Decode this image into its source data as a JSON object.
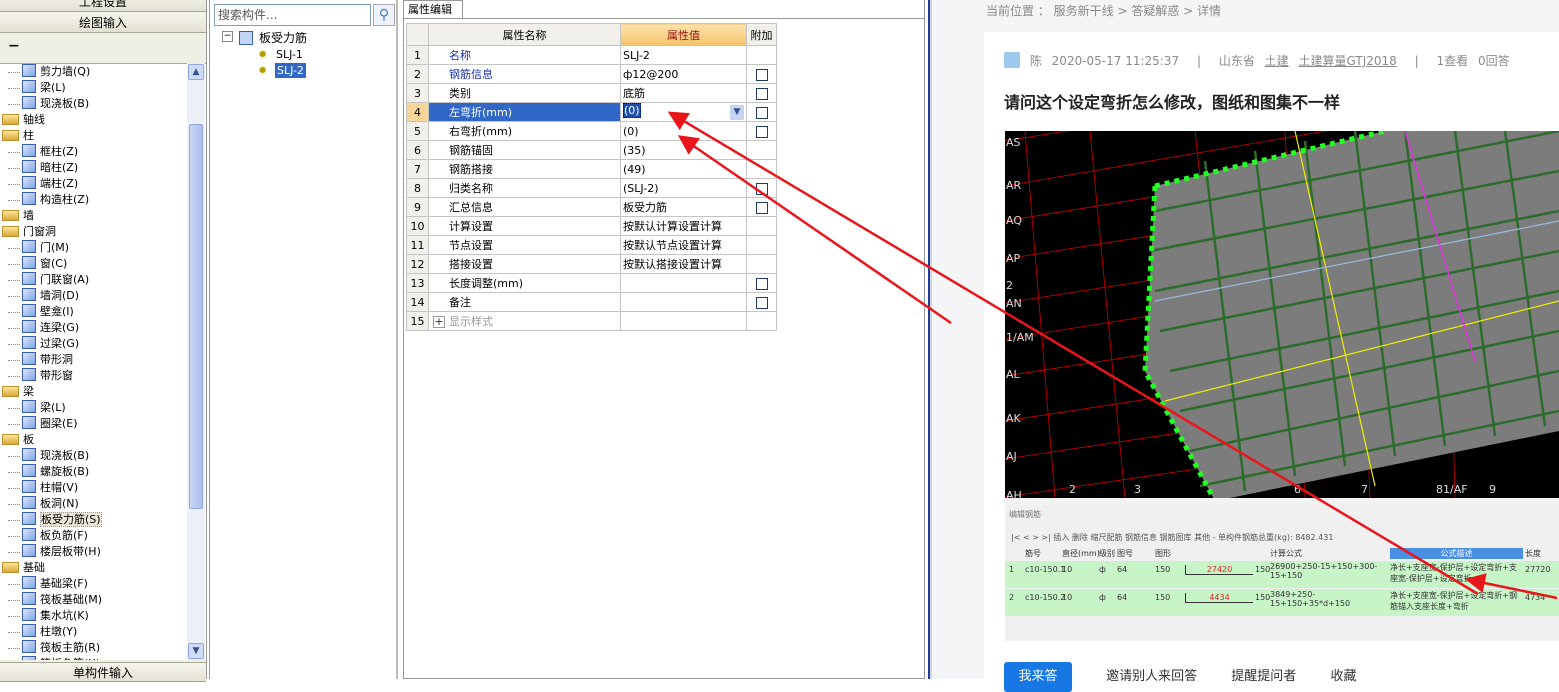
{
  "left_panel": {
    "top_button": "工程设置",
    "draw_input": "绘图输入",
    "collapse_icon": "−",
    "bottom_button": "单构件输入",
    "tree": [
      {
        "label": "剪力墙(Q)",
        "type": "child"
      },
      {
        "label": "梁(L)",
        "type": "child"
      },
      {
        "label": "现浇板(B)",
        "type": "child"
      },
      {
        "label": "轴线",
        "type": "folder"
      },
      {
        "label": "柱",
        "type": "folder"
      },
      {
        "label": "框柱(Z)",
        "type": "child"
      },
      {
        "label": "暗柱(Z)",
        "type": "child"
      },
      {
        "label": "端柱(Z)",
        "type": "child"
      },
      {
        "label": "构造柱(Z)",
        "type": "child"
      },
      {
        "label": "墙",
        "type": "folder"
      },
      {
        "label": "门窗洞",
        "type": "folder"
      },
      {
        "label": "门(M)",
        "type": "child"
      },
      {
        "label": "窗(C)",
        "type": "child"
      },
      {
        "label": "门联窗(A)",
        "type": "child"
      },
      {
        "label": "墙洞(D)",
        "type": "child"
      },
      {
        "label": "壁龛(I)",
        "type": "child"
      },
      {
        "label": "连梁(G)",
        "type": "child"
      },
      {
        "label": "过梁(G)",
        "type": "child"
      },
      {
        "label": "带形洞",
        "type": "child"
      },
      {
        "label": "带形窗",
        "type": "child"
      },
      {
        "label": "梁",
        "type": "folder"
      },
      {
        "label": "梁(L)",
        "type": "child"
      },
      {
        "label": "圈梁(E)",
        "type": "child"
      },
      {
        "label": "板",
        "type": "folder"
      },
      {
        "label": "现浇板(B)",
        "type": "child"
      },
      {
        "label": "螺旋板(B)",
        "type": "child"
      },
      {
        "label": "柱帽(V)",
        "type": "child"
      },
      {
        "label": "板洞(N)",
        "type": "child"
      },
      {
        "label": "板受力筋(S)",
        "type": "child",
        "selected": true
      },
      {
        "label": "板负筋(F)",
        "type": "child"
      },
      {
        "label": "楼层板带(H)",
        "type": "child"
      },
      {
        "label": "基础",
        "type": "folder"
      },
      {
        "label": "基础梁(F)",
        "type": "child"
      },
      {
        "label": "筏板基础(M)",
        "type": "child"
      },
      {
        "label": "集水坑(K)",
        "type": "child"
      },
      {
        "label": "柱墩(Y)",
        "type": "child"
      },
      {
        "label": "筏板主筋(R)",
        "type": "child"
      },
      {
        "label": "筏板负筋(X)",
        "type": "child"
      }
    ]
  },
  "component_tree": {
    "search_placeholder": "搜索构件...",
    "root": "板受力筋",
    "items": [
      "SLJ-1",
      "SLJ-2"
    ],
    "selected": "SLJ-2"
  },
  "property_editor": {
    "tab": "属性编辑",
    "headers": {
      "name": "属性名称",
      "value": "属性值",
      "extra": "附加"
    },
    "rows": [
      {
        "no": "1",
        "name": "名称",
        "value": "SLJ-2",
        "blue": true,
        "check": false
      },
      {
        "no": "2",
        "name": "钢筋信息",
        "value": "ф12@200",
        "blue": true,
        "check": true
      },
      {
        "no": "3",
        "name": "类别",
        "value": "底筋",
        "check": true
      },
      {
        "no": "4",
        "name": "左弯折(mm)",
        "value": "(0)",
        "check": true,
        "selected": true
      },
      {
        "no": "5",
        "name": "右弯折(mm)",
        "value": "(0)",
        "check": true
      },
      {
        "no": "6",
        "name": "钢筋锚固",
        "value": "(35)",
        "check": false
      },
      {
        "no": "7",
        "name": "钢筋搭接",
        "value": "(49)",
        "check": false
      },
      {
        "no": "8",
        "name": "归类名称",
        "value": "(SLJ-2)",
        "check": true
      },
      {
        "no": "9",
        "name": "汇总信息",
        "value": "板受力筋",
        "check": true
      },
      {
        "no": "10",
        "name": "计算设置",
        "value": "按默认计算设置计算",
        "check": false
      },
      {
        "no": "11",
        "name": "节点设置",
        "value": "按默认节点设置计算",
        "check": false
      },
      {
        "no": "12",
        "name": "搭接设置",
        "value": "按默认搭接设置计算",
        "check": false
      },
      {
        "no": "13",
        "name": "长度调整(mm)",
        "value": "",
        "check": true
      },
      {
        "no": "14",
        "name": "备注",
        "value": "",
        "check": true
      },
      {
        "no": "15",
        "name": "显示样式",
        "value": "",
        "check": false,
        "expand": "+",
        "gray": true
      }
    ]
  },
  "web": {
    "breadcrumb": "当前位置 ： 服务新干线 > 答疑解惑 > 详情",
    "author": "陈",
    "datetime": "2020-05-17 11:25:37",
    "sep": "|",
    "region": "山东省",
    "tag1": "土建",
    "tag2": "土建算量GTJ2018",
    "views": "1查看",
    "answers": "0回答",
    "title": "请问这个设定弯折怎么修改，图纸和图集不一样",
    "cad_axes_left": [
      "AS",
      "AR",
      "AQ",
      "AP",
      "2",
      "AN",
      "1/AM",
      "AL",
      "AK",
      "AJ",
      "AH"
    ],
    "cad_axes_bottom": [
      "2",
      "3",
      "6",
      "7",
      "81/AF",
      "9"
    ],
    "rebar_panel": {
      "title": "编辑钢筋",
      "toolbar": "|< < > >|  插入  删除  缩尺配筋  钢筋信息  钢筋图库  其他 - 单构件钢筋总重(kg): 8482.431",
      "headers": [
        "筋号",
        "直径(mm)",
        "级别",
        "图号",
        "图形",
        "计算公式",
        "公式描述",
        "长度"
      ],
      "rows": [
        {
          "no": "1",
          "bar": "c10-150.1",
          "dia": "10",
          "grade": "ф",
          "fig": "64",
          "left": "150",
          "len": "27420",
          "right": "150",
          "formula": "26900+250-15+150+300-15+150",
          "desc": "净长+支座宽-保护层+设定弯折+支座宽-保护层+设定弯折",
          "total": "27720"
        },
        {
          "no": "2",
          "bar": "c10-150.2",
          "dia": "10",
          "grade": "ф",
          "fig": "64",
          "left": "150",
          "len": "4434",
          "right": "150",
          "formula": "3849+250-15+150+35*d+150",
          "desc": "净长+支座宽-保护层+设定弯折+钢筋锚入支座长度+弯折",
          "total": "4734"
        }
      ]
    },
    "actions": {
      "answer": "我来答",
      "invite": "邀请别人来回答",
      "remind": "提醒提问者",
      "favorite": "收藏"
    }
  },
  "colors": {
    "annotation_arrow": "#e8161b",
    "selection": "#3168c8",
    "web_button": "#1677e5"
  }
}
